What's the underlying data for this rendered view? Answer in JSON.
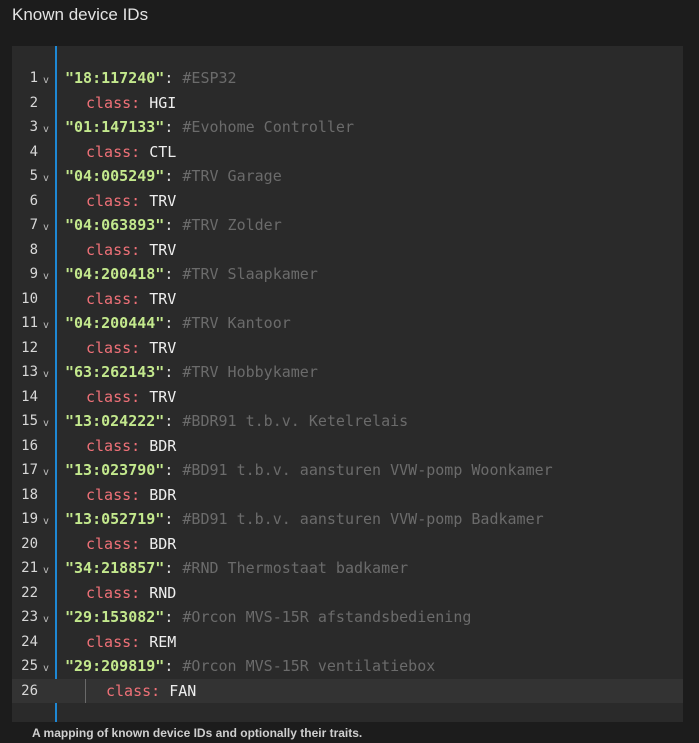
{
  "section_title": "Known device IDs",
  "helper_text": "A mapping of known device IDs and optionally their traits.",
  "entries": [
    {
      "id": "\"18:117240\"",
      "comment": "#ESP32",
      "class_label": "class:",
      "class_value": "HGI"
    },
    {
      "id": "\"01:147133\"",
      "comment": "#Evohome Controller",
      "class_label": "class:",
      "class_value": "CTL"
    },
    {
      "id": "\"04:005249\"",
      "comment": "#TRV Garage",
      "class_label": "class:",
      "class_value": "TRV"
    },
    {
      "id": "\"04:063893\"",
      "comment": "#TRV Zolder",
      "class_label": "class:",
      "class_value": "TRV"
    },
    {
      "id": "\"04:200418\"",
      "comment": "#TRV Slaapkamer",
      "class_label": "class:",
      "class_value": "TRV"
    },
    {
      "id": "\"04:200444\"",
      "comment": "#TRV Kantoor",
      "class_label": "class:",
      "class_value": "TRV"
    },
    {
      "id": "\"63:262143\"",
      "comment": "#TRV Hobbykamer",
      "class_label": "class:",
      "class_value": "TRV"
    },
    {
      "id": "\"13:024222\"",
      "comment": "#BDR91 t.b.v. Ketelrelais",
      "class_label": "class:",
      "class_value": "BDR"
    },
    {
      "id": "\"13:023790\"",
      "comment": "#BD91 t.b.v. aansturen VVW-pomp Woonkamer",
      "class_label": "class:",
      "class_value": "BDR"
    },
    {
      "id": "\"13:052719\"",
      "comment": "#BD91 t.b.v. aansturen VVW-pomp Badkamer",
      "class_label": "class:",
      "class_value": "BDR"
    },
    {
      "id": "\"34:218857\"",
      "comment": "#RND Thermostaat badkamer",
      "class_label": "class:",
      "class_value": "RND"
    },
    {
      "id": "\"29:153082\"",
      "comment": "#Orcon MVS-15R afstandsbediening",
      "class_label": "class:",
      "class_value": "REM"
    },
    {
      "id": "\"29:209819\"",
      "comment": "#Orcon MVS-15R ventilatiebox",
      "class_label": "class:",
      "class_value": "FAN"
    }
  ],
  "fold_icon": "chevron-down-icon"
}
